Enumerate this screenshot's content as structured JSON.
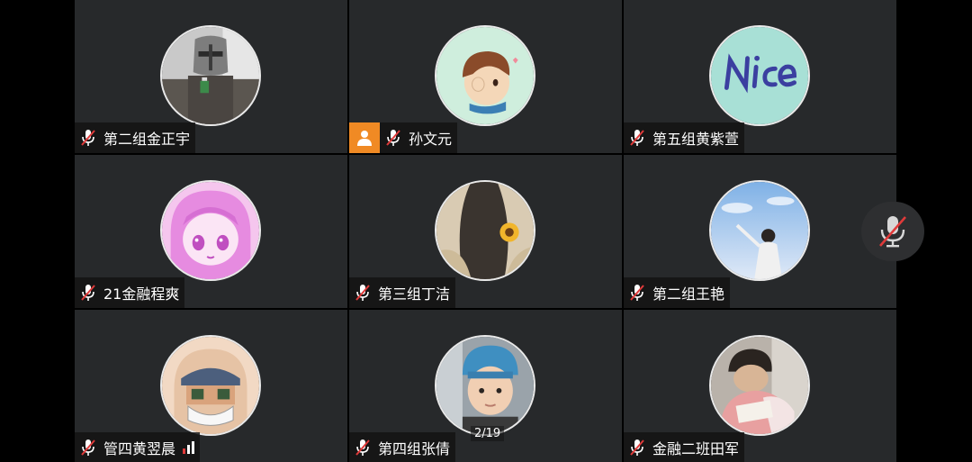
{
  "participants": [
    {
      "name": "第二组金正宇",
      "avatar": "knight-helmet-photo",
      "muted": true,
      "host": false,
      "signal": false
    },
    {
      "name": "孙文元",
      "avatar": "cartoon-boy-avatar",
      "muted": true,
      "host": true,
      "signal": false
    },
    {
      "name": "第五组黄紫萱",
      "avatar": "nice-text-avatar",
      "muted": true,
      "host": false,
      "signal": false
    },
    {
      "name": "21金融程爽",
      "avatar": "pink-anime-girl-avatar",
      "muted": true,
      "host": false,
      "signal": false
    },
    {
      "name": "第三组丁洁",
      "avatar": "sunflower-hair-avatar",
      "muted": true,
      "host": false,
      "signal": false
    },
    {
      "name": "第二组王艳",
      "avatar": "sky-girl-avatar",
      "muted": true,
      "host": false,
      "signal": false
    },
    {
      "name": "管四黄翌晨",
      "avatar": "cartoon-masked-avatar",
      "muted": true,
      "host": false,
      "signal": true
    },
    {
      "name": "第四组张倩",
      "avatar": "child-blue-hat-avatar",
      "muted": true,
      "host": false,
      "signal": false
    },
    {
      "name": "金融二班田军",
      "avatar": "boy-reading-avatar",
      "muted": true,
      "host": false,
      "signal": false
    }
  ],
  "page_indicator": "2/19",
  "colors": {
    "tile_bg": "#27292b",
    "host_badge": "#f08a24",
    "mic_muted_slash": "#e03a3a"
  }
}
